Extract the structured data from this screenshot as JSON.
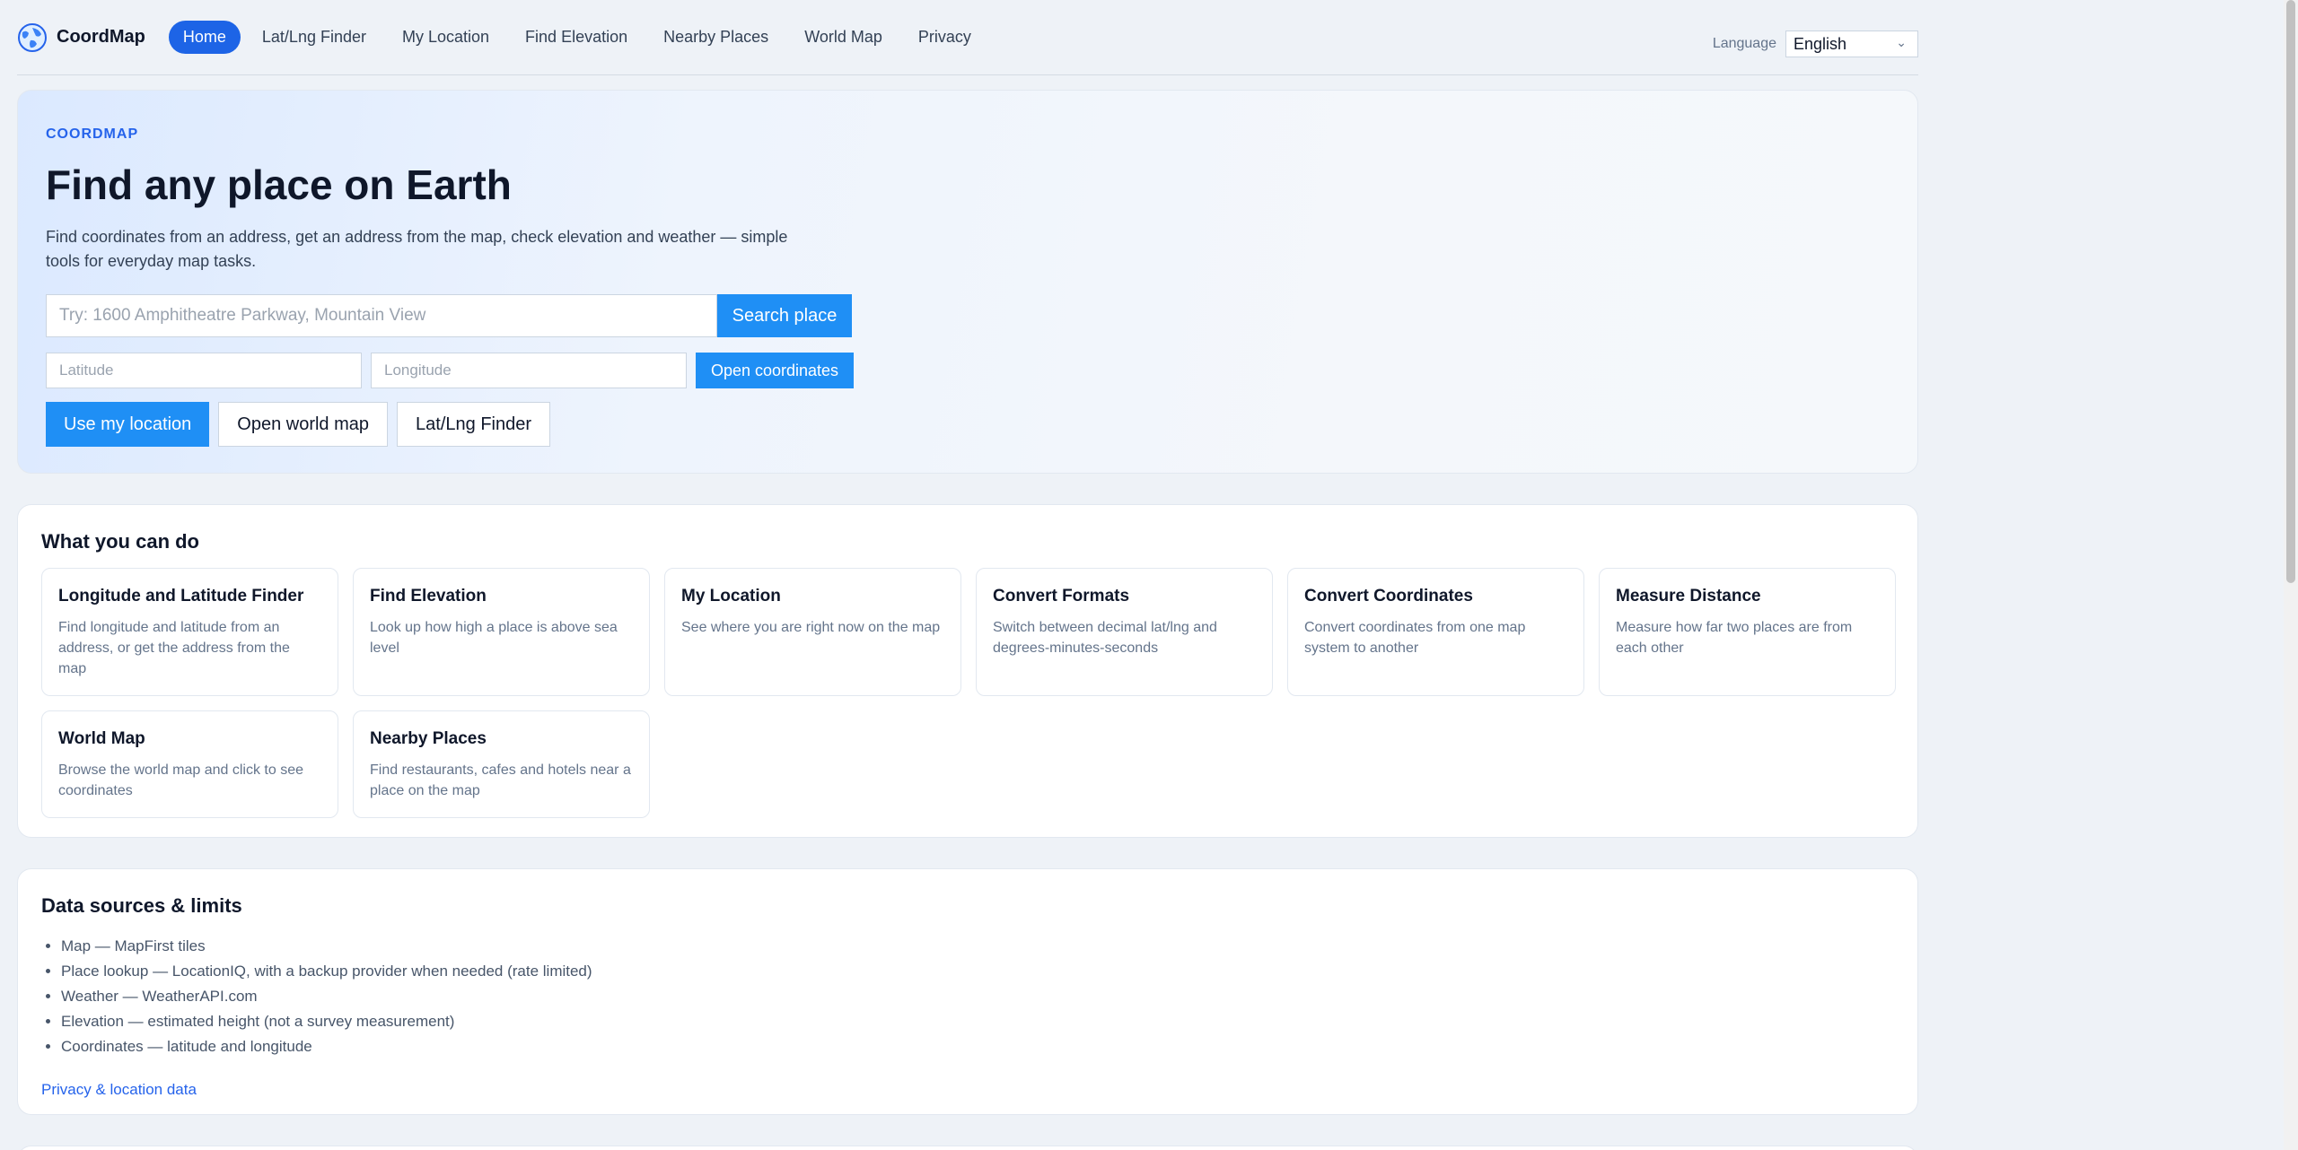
{
  "nav": {
    "brand": "CoordMap",
    "links": [
      "Home",
      "Lat/Lng Finder",
      "My Location",
      "Find Elevation",
      "Nearby Places",
      "World Map",
      "Privacy"
    ],
    "language_label": "Language",
    "language_value": "English"
  },
  "hero": {
    "eyebrow": "COORDMAP",
    "title": "Find any place on Earth",
    "description": "Find coordinates from an address, get an address from the map, check elevation and weather — simple tools for everyday map tasks.",
    "search_placeholder": "Try: 1600 Amphitheatre Parkway, Mountain View",
    "search_button": "Search place",
    "lat_placeholder": "Latitude",
    "lng_placeholder": "Longitude",
    "open_coords_button": "Open coordinates",
    "use_location_button": "Use my location",
    "world_map_button": "Open world map",
    "finder_button": "Lat/Lng Finder"
  },
  "features": {
    "title": "What you can do",
    "items": [
      {
        "title": "Longitude and Latitude Finder",
        "desc": "Find longitude and latitude from an address, or get the address from the map"
      },
      {
        "title": "Find Elevation",
        "desc": "Look up how high a place is above sea level"
      },
      {
        "title": "My Location",
        "desc": "See where you are right now on the map"
      },
      {
        "title": "Convert Formats",
        "desc": "Switch between decimal lat/lng and degrees-minutes-seconds"
      },
      {
        "title": "Convert Coordinates",
        "desc": "Convert coordinates from one map system to another"
      },
      {
        "title": "Measure Distance",
        "desc": "Measure how far two places are from each other"
      },
      {
        "title": "World Map",
        "desc": "Browse the world map and click to see coordinates"
      },
      {
        "title": "Nearby Places",
        "desc": "Find restaurants, cafes and hotels near a place on the map"
      }
    ]
  },
  "sources": {
    "title": "Data sources & limits",
    "items": [
      "Map — MapFirst tiles",
      "Place lookup — LocationIQ, with a backup provider when needed (rate limited)",
      "Weather — WeatherAPI.com",
      "Elevation — estimated height (not a survey measurement)",
      "Coordinates — latitude and longitude"
    ],
    "link": "Privacy & location data"
  }
}
